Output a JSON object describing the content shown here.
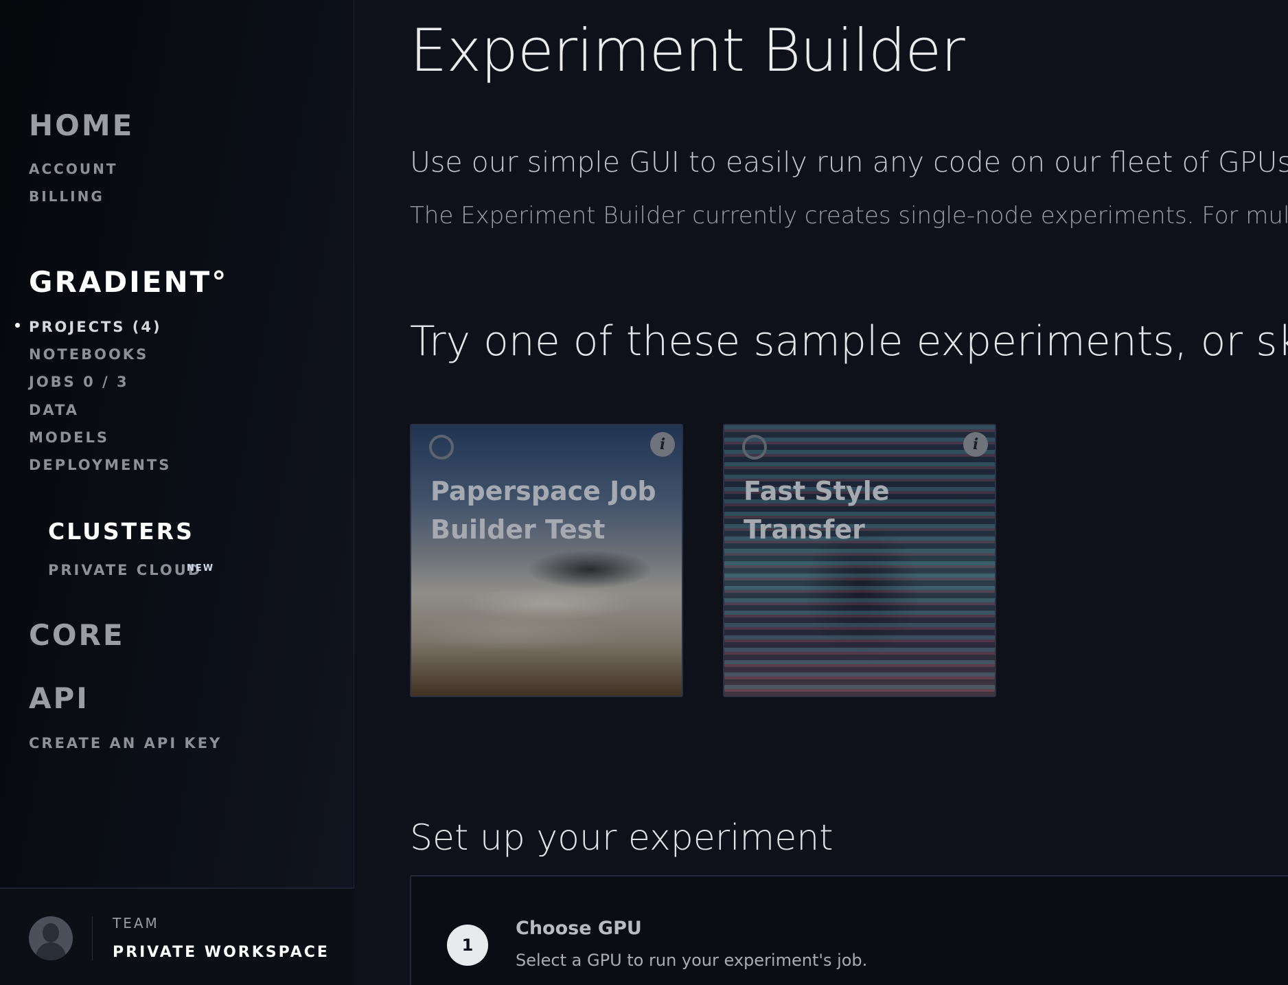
{
  "sidebar": {
    "home": {
      "title": "HOME",
      "links": [
        "ACCOUNT",
        "BILLING"
      ]
    },
    "gradient": {
      "title": "GRADIENT°",
      "links": [
        "PROJECTS (4)",
        "NOTEBOOKS",
        "JOBS 0 / 3",
        "DATA",
        "MODELS",
        "DEPLOYMENTS"
      ],
      "active_index": 0
    },
    "clusters": {
      "title": "CLUSTERS",
      "link": "PRIVATE CLOUD",
      "badge": "NEW"
    },
    "core": {
      "title": "CORE"
    },
    "api": {
      "title": "API",
      "link": "CREATE AN API KEY"
    },
    "footer": {
      "team_label": "TEAM",
      "workspace": "PRIVATE WORKSPACE",
      "avatar_icon": "user-avatar-icon"
    }
  },
  "main": {
    "title": "Experiment Builder",
    "intro": "Use our simple GUI to easily run any code on our fleet of GPUs.",
    "intro_sub": "The Experiment Builder currently creates single-node experiments. For multin",
    "samples_heading": "Try one of these sample experiments, or skip",
    "samples": [
      {
        "title": "Paperspace Job Builder Test",
        "info_icon": "info-icon",
        "selected": false
      },
      {
        "title": "Fast Style Transfer",
        "info_icon": "info-icon",
        "selected": false
      }
    ],
    "setup_heading": "Set up your experiment",
    "steps": [
      {
        "number": "1",
        "title": "Choose GPU",
        "description": "Select a GPU to run your experiment's job."
      }
    ]
  }
}
